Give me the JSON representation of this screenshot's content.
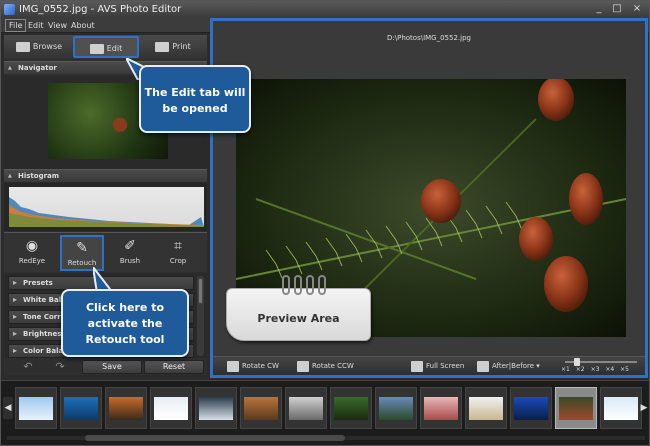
{
  "window": {
    "title": "IMG_0552.jpg - AVS Photo Editor",
    "controls": [
      "_",
      "□",
      "×"
    ]
  },
  "menu": [
    "File",
    "Edit",
    "View",
    "About"
  ],
  "modes": {
    "browse": "Browse",
    "edit": "Edit",
    "print": "Print"
  },
  "sections": {
    "navigator": "Navigator",
    "histogram": "Histogram"
  },
  "tools": {
    "redeye": "RedEye",
    "retouch": "Retouch",
    "brush": "Brush",
    "crop": "Crop"
  },
  "presets": [
    "Presets",
    "White Balan",
    "Tone Corre",
    "Brightness/",
    "Color Balan"
  ],
  "actions": {
    "save": "Save",
    "reset": "Reset"
  },
  "preview": {
    "path": "D:\\Photos\\IMG_0552.jpg"
  },
  "bottombar": {
    "rotate_cw": "Rotate CW",
    "rotate_ccw": "Rotate CCW",
    "full_screen": "Full Screen",
    "after_before": "After|Before"
  },
  "zoom": {
    "labels": [
      "×1",
      "×2",
      "×3",
      "×4",
      "×5"
    ]
  },
  "callouts": {
    "edit_tab": "The Edit tab will be opened",
    "retouch": "Click here to activate the Retouch tool",
    "preview_area": "Preview Area"
  },
  "colors": {
    "highlight": "#2f70c8",
    "callout_bg": "#1f5a9a"
  }
}
